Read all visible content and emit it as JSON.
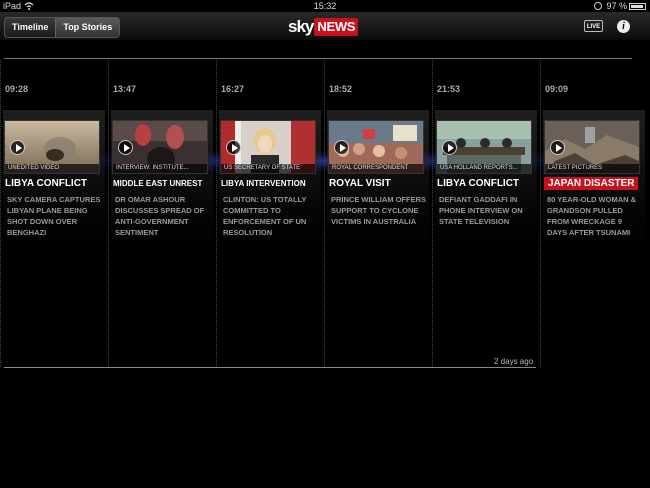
{
  "status_bar": {
    "device": "iPad",
    "time": "15:32",
    "battery": "97 %"
  },
  "nav": {
    "tabs": [
      {
        "label": "Timeline",
        "active": false
      },
      {
        "label": "Top Stories",
        "active": true
      }
    ],
    "logo_sky": "sky",
    "logo_news": "NEWS",
    "live_label": "LIVE",
    "info_label": "i"
  },
  "colors": {
    "accent_red": "#c8101e",
    "glow_blue": "#4a5aff"
  },
  "stories": [
    {
      "time": "09:28",
      "caption": "UNEDITED VIDEO",
      "headline": "LIBYA CONFLICT",
      "summary": "SKY CAMERA CAPTURES LIBYAN PLANE BEING SHOT DOWN OVER BENGHAZI"
    },
    {
      "time": "13:47",
      "caption": "INTERVIEW: INSTITUTE...",
      "headline": "MIDDLE EAST UNREST",
      "summary": "DR OMAR ASHOUR DISCUSSES SPREAD OF ANTI-GOVERNMENT SENTIMENT"
    },
    {
      "time": "16:27",
      "caption": "US SECRETARY OF STATE",
      "headline": "LIBYA INTERVENTION",
      "summary": "CLINTON: US TOTALLY COMMITTED TO ENFORCEMENT OF UN RESOLUTION"
    },
    {
      "time": "18:52",
      "caption": "ROYAL CORRESPONDENT",
      "headline": "ROYAL VISIT",
      "summary": "PRINCE WILLIAM OFFERS SUPPORT TO CYCLONE VICTIMS IN AUSTRALIA"
    },
    {
      "time": "21:53",
      "caption": "USA HOLLAND REPORTS...",
      "headline": "LIBYA CONFLICT",
      "summary": "DEFIANT GADDAFI IN PHONE INTERVIEW ON STATE TELEVISION"
    },
    {
      "time": "09:09",
      "caption": "LATEST PICTURES",
      "headline": "JAPAN DISASTER",
      "summary": "80 YEAR-OLD WOMAN & GRANDSON PULLED FROM WRECKAGE 9 DAYS AFTER TSUNAMI"
    }
  ],
  "footer": {
    "days_ago": "2 days ago"
  }
}
